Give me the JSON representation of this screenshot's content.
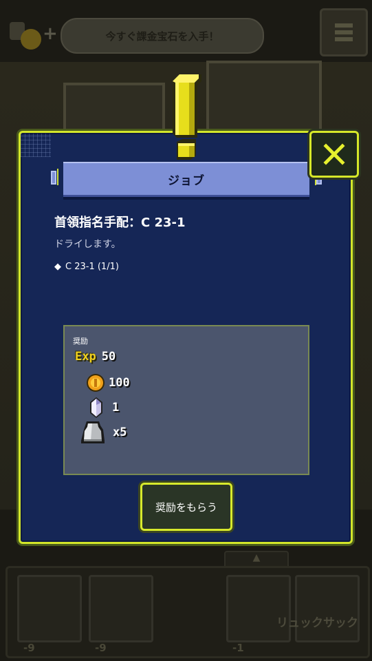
{
  "background": {
    "banner_text": "今すぐ課金宝石を入手！",
    "bag_label": "リュックサック",
    "slot_counts": [
      "-9",
      "-9",
      "-1"
    ],
    "tab_arrow": "▲"
  },
  "dialog": {
    "title": "ジョブ",
    "job_name": "首領指名手配：C 23-1",
    "job_desc": "ドライします。",
    "condition_prefix": "◆",
    "condition": "C 23-1 (1/1)",
    "reward_heading": "奨励",
    "rewards": {
      "exp_label": "Exp",
      "exp_value": "50",
      "coin_value": "100",
      "gem_value": "1",
      "item_value": "x5"
    },
    "claim_button": "奨励をもらう",
    "close_icon": "close-x-icon"
  },
  "colors": {
    "panel": "#152656",
    "accent_border": "#d3e62a",
    "title_bar": "#7d8fd6",
    "reward_box": "#4b556d",
    "exp_gold": "#f2d21e"
  }
}
